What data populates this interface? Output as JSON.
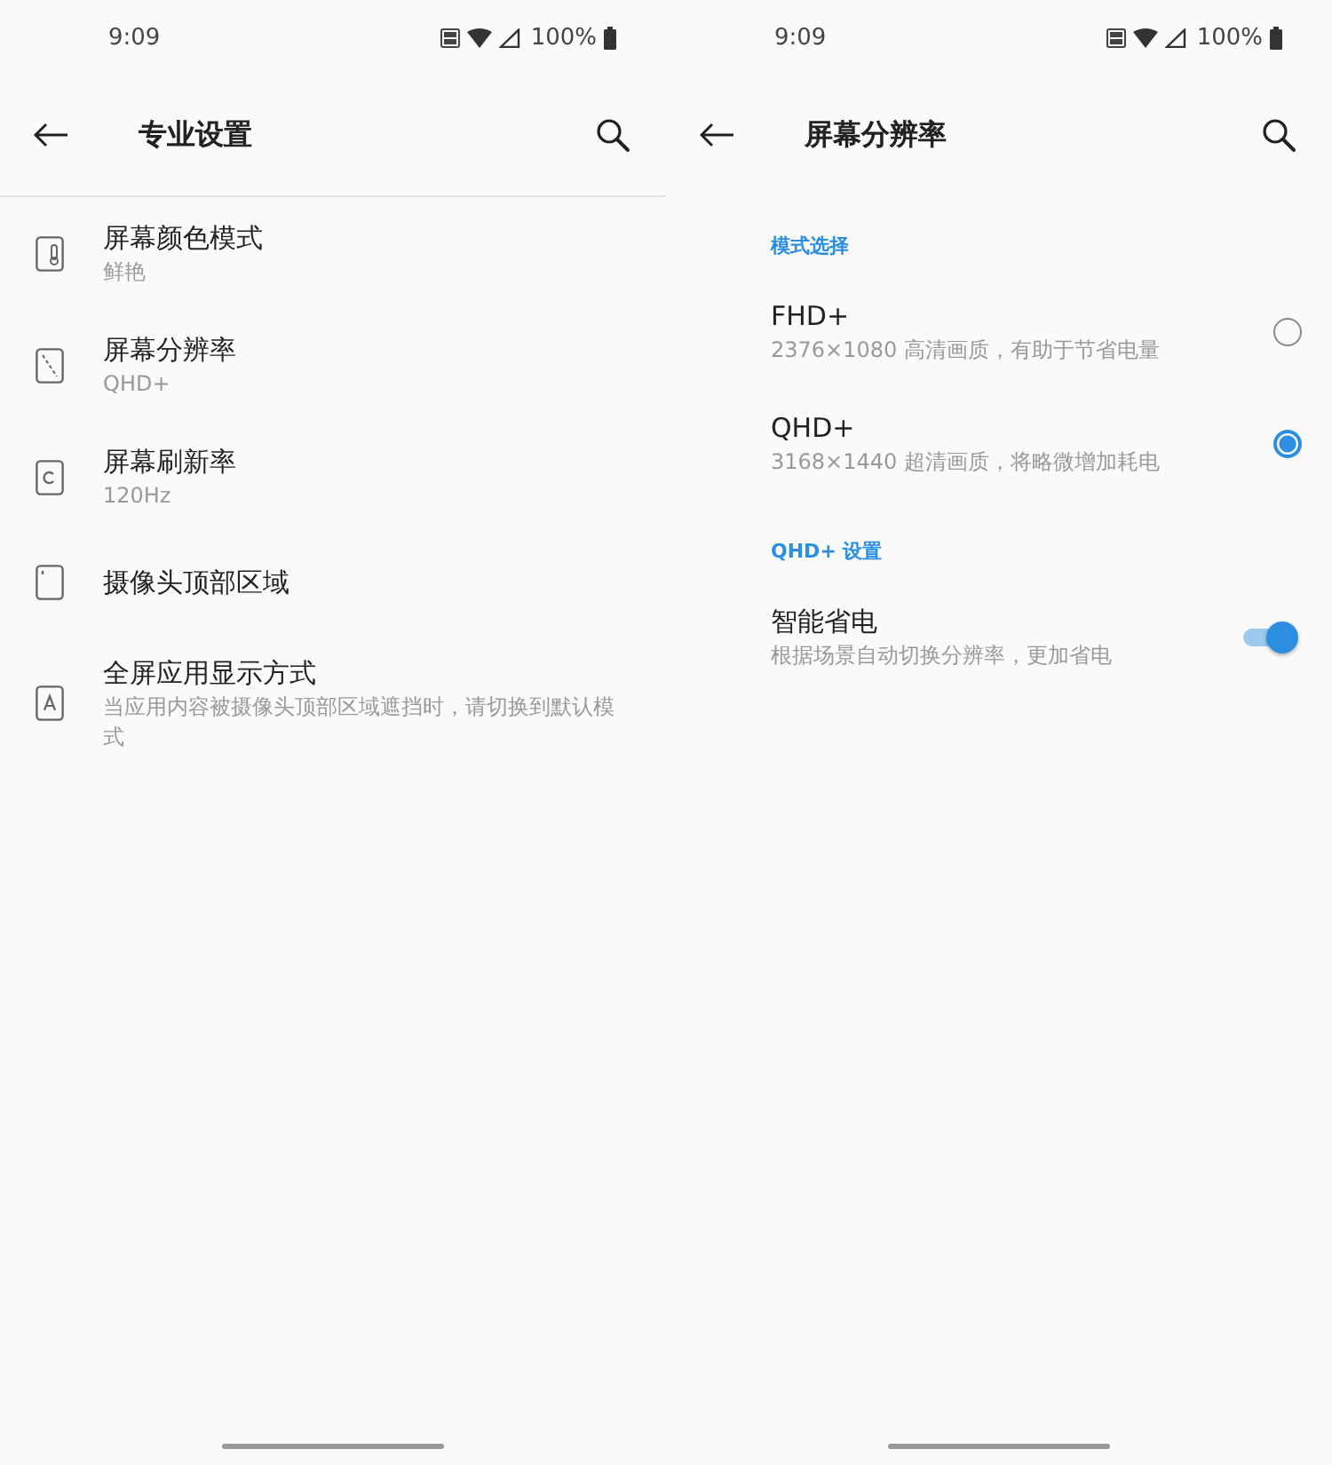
{
  "left": {
    "status_bar": {
      "time": "9:09",
      "battery": "100%"
    },
    "header": {
      "title": "专业设置"
    },
    "items": [
      {
        "title": "屏幕颜色模式",
        "subtitle": "鲜艳"
      },
      {
        "title": "屏幕分辨率",
        "subtitle": "QHD+"
      },
      {
        "title": "屏幕刷新率",
        "subtitle": "120Hz"
      },
      {
        "title": "摄像头顶部区域"
      },
      {
        "title": "全屏应用显示方式",
        "subtitle": "当应用内容被摄像头顶部区域遮挡时，请切换到默认模式"
      }
    ]
  },
  "right": {
    "status_bar": {
      "time": "9:09",
      "battery": "100%"
    },
    "header": {
      "title": "屏幕分辨率"
    },
    "sections": [
      {
        "heading": "模式选择",
        "items": [
          {
            "kind": "radio",
            "title": "FHD+",
            "subtitle": "2376×1080 高清画质，有助于节省电量",
            "selected": false
          },
          {
            "kind": "radio",
            "title": "QHD+",
            "subtitle": "3168×1440 超清画质，将略微增加耗电",
            "selected": true
          }
        ]
      },
      {
        "heading": "QHD+ 设置",
        "items": [
          {
            "kind": "switch",
            "title": "智能省电",
            "subtitle": "根据场景自动切换分辨率，更加省电",
            "on": true
          }
        ]
      }
    ]
  }
}
